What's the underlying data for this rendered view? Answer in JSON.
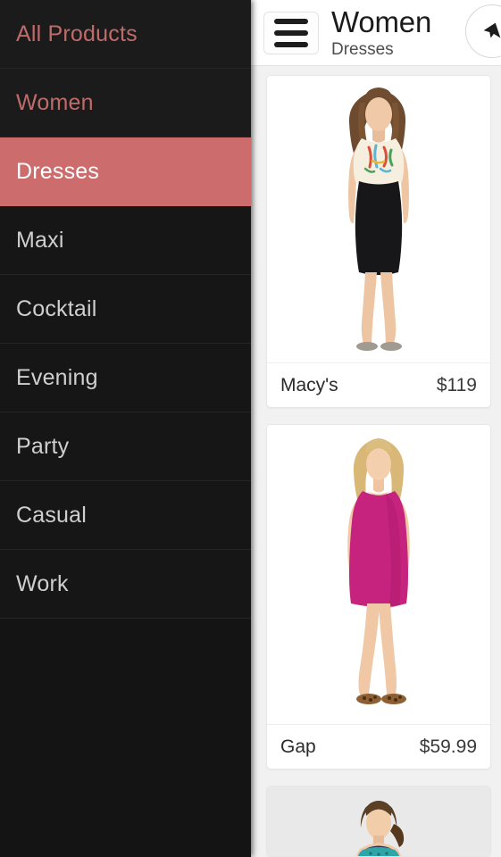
{
  "sidebar": {
    "items": [
      {
        "label": "All Products",
        "style": "accent",
        "selected": false
      },
      {
        "label": "Women",
        "style": "accent",
        "selected": false
      },
      {
        "label": "Dresses",
        "style": "selected",
        "selected": true
      },
      {
        "label": "Maxi",
        "style": "normal",
        "selected": false
      },
      {
        "label": "Cocktail",
        "style": "normal",
        "selected": false
      },
      {
        "label": "Evening",
        "style": "normal",
        "selected": false
      },
      {
        "label": "Party",
        "style": "normal",
        "selected": false
      },
      {
        "label": "Casual",
        "style": "normal",
        "selected": false
      },
      {
        "label": "Work",
        "style": "normal",
        "selected": false
      }
    ]
  },
  "header": {
    "menu_icon": "hamburger-menu-icon",
    "title": "Women",
    "subtitle": "Dresses",
    "action_icon": "share-arrow-icon"
  },
  "products": [
    {
      "brand": "Macy's",
      "price": "$119",
      "image_alt": "model-in-printed-top-and-black-pencil-skirt",
      "bg": "#ffffff"
    },
    {
      "brand": "Gap",
      "price": "$59.99",
      "image_alt": "model-in-magenta-sleeveless-shift-dress",
      "bg": "#ffffff"
    },
    {
      "brand": "",
      "price": "",
      "image_alt": "model-in-teal-patterned-dress-partial",
      "bg": "#e9e9e9"
    }
  ],
  "colors": {
    "accent": "#cd6c6c",
    "accent_text": "#c06b6b",
    "sidebar_bg": "#181818",
    "panel_bg": "#f1f1f1",
    "card_bg": "#ffffff"
  }
}
